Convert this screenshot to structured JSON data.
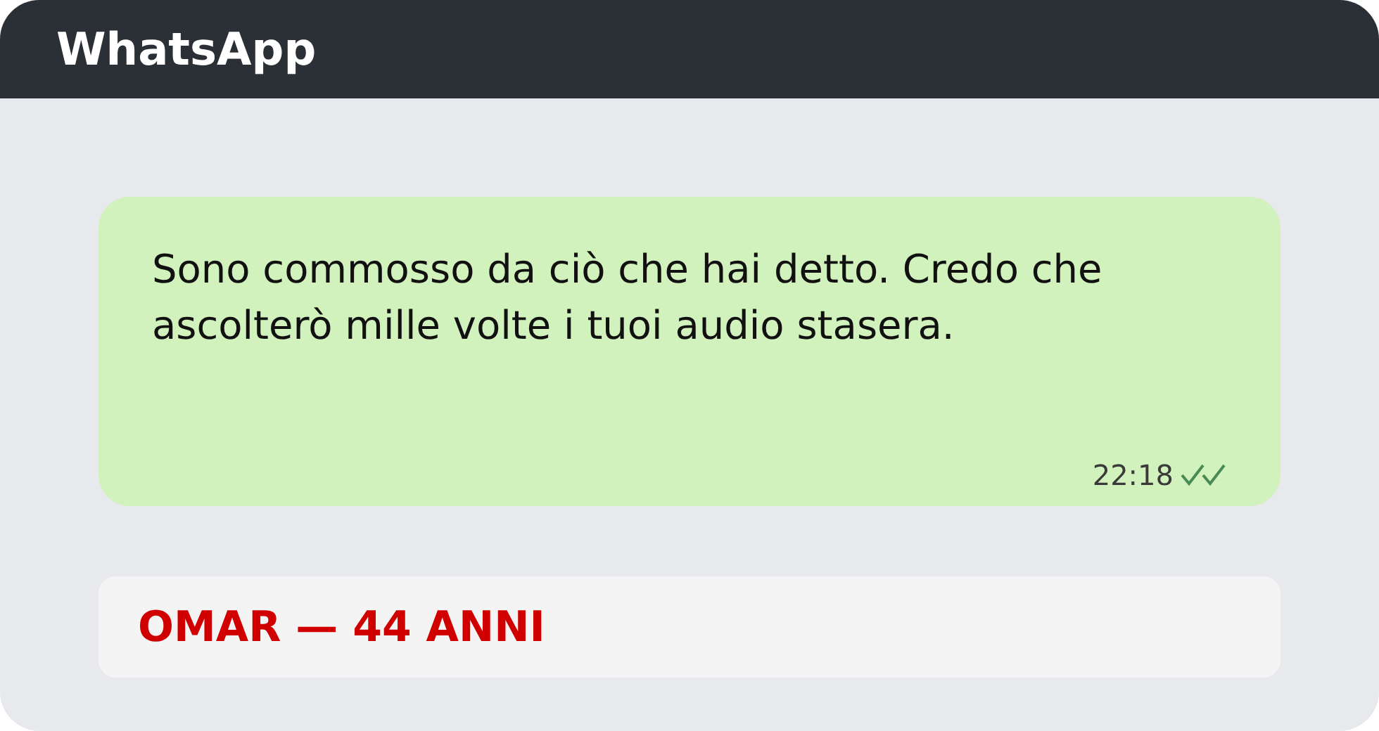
{
  "window": {
    "title": "WhatsApp"
  },
  "message": {
    "text": "Sono commosso da ciò che hai detto. Credo che ascolterò mille volte i tuoi audio stasera.",
    "time": "22:18",
    "read": true
  },
  "caption": {
    "text": "OMAR — 44 ANNI"
  }
}
